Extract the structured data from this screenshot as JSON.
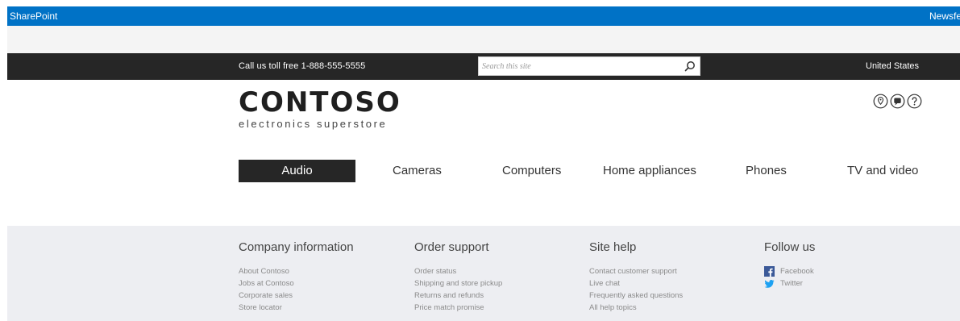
{
  "suite_bar": {
    "brand": "SharePoint",
    "newsfeed": "Newsfeed",
    "color": "#0072c6"
  },
  "top_bar": {
    "call_text": "Call us toll free 1-888-555-5555",
    "search_placeholder": "Search this site",
    "search_value": "",
    "country": "United States",
    "color": "#262626"
  },
  "logo": {
    "wordmark": "CONTOSO",
    "tagline": "electronics superstore"
  },
  "utility_icons": [
    "location-icon",
    "chat-icon",
    "help-icon"
  ],
  "nav": {
    "items": [
      "Audio",
      "Cameras",
      "Computers",
      "Home appliances",
      "Phones",
      "TV and video"
    ],
    "active": "Audio"
  },
  "footer": {
    "columns": [
      {
        "heading": "Company information",
        "links": [
          "About Contoso",
          "Jobs at Contoso",
          "Corporate sales",
          "Store locator"
        ]
      },
      {
        "heading": "Order support",
        "links": [
          "Order status",
          "Shipping and store pickup",
          "Returns and refunds",
          "Price match promise"
        ]
      },
      {
        "heading": "Site help",
        "links": [
          "Contact customer support",
          "Live chat",
          "Frequently asked questions",
          "All help topics"
        ]
      },
      {
        "heading": "Follow us",
        "links": [
          "Facebook",
          "Twitter"
        ]
      }
    ],
    "background": "#edeef2"
  }
}
